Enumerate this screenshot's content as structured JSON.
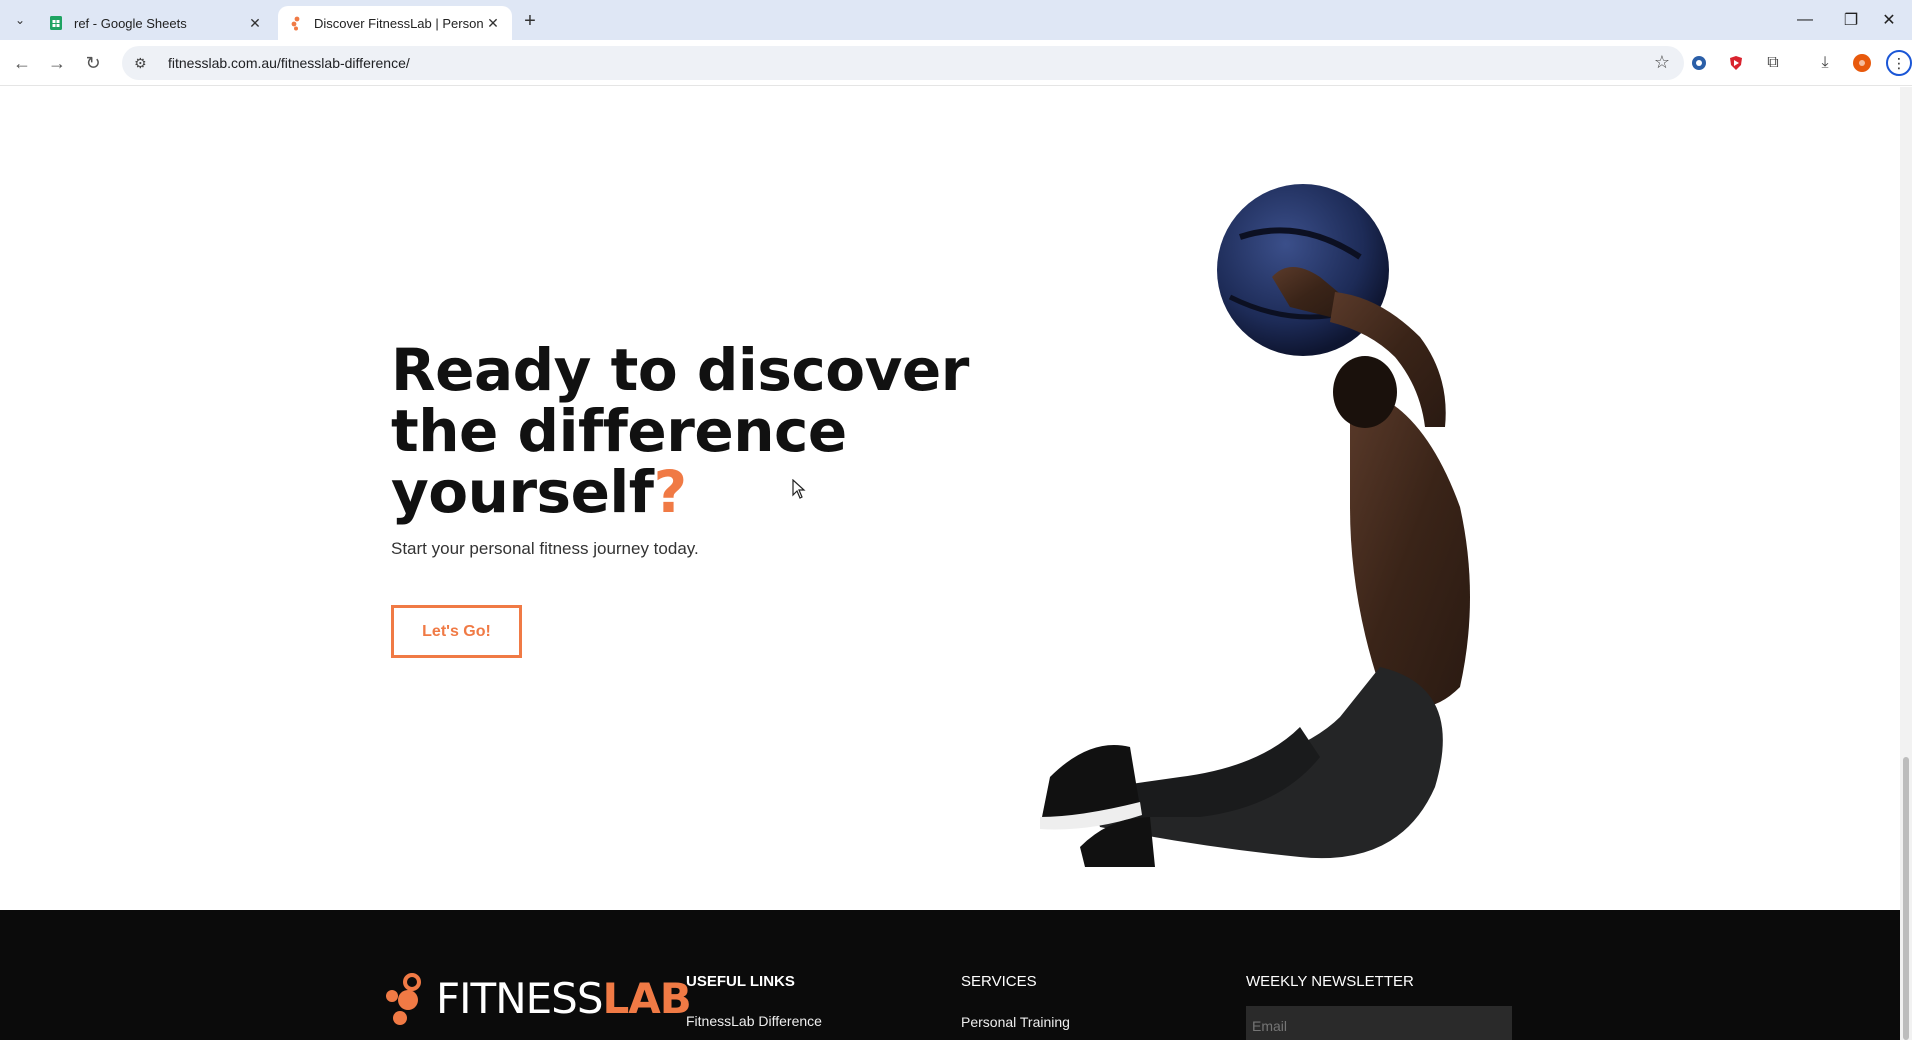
{
  "browser": {
    "tabs": [
      {
        "title": "ref - Google Sheets",
        "active": false
      },
      {
        "title": "Discover FitnessLab | Personal T",
        "active": true
      }
    ],
    "url": "fitnesslab.com.au/fitnesslab-difference/"
  },
  "hero": {
    "headline_line1": "Ready to discover",
    "headline_line2": "the difference",
    "headline_line3": "yourself",
    "headline_mark": "?",
    "subtext": "Start your personal fitness journey today.",
    "cta_label": "Let's Go!"
  },
  "footer": {
    "logo_fit": "FITNESS",
    "logo_lab": "LAB",
    "col1_title": "USEFUL LINKS",
    "col1_link": "FitnessLab Difference",
    "col2_title": "SERVICES",
    "col2_link": "Personal Training",
    "col3_title": "WEEKLY NEWSLETTER",
    "email_placeholder": "Email"
  },
  "colors": {
    "accent": "#f07a45",
    "footer_bg": "#0b0b0b"
  }
}
